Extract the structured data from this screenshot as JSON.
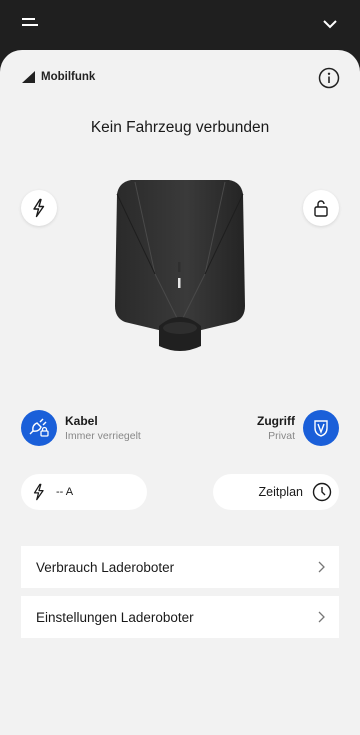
{
  "network": {
    "label": "Mobilfunk",
    "icon": "signal-icon"
  },
  "status_title": "Kein Fahrzeug verbunden",
  "cable": {
    "title": "Kabel",
    "subtitle": "Immer verriegelt",
    "icon": "plug-lock-icon"
  },
  "access": {
    "title": "Zugriff",
    "subtitle": "Privat",
    "icon": "shield-icon"
  },
  "current": {
    "value": "-- A",
    "icon": "lightning-icon"
  },
  "schedule": {
    "label": "Zeitplan",
    "icon": "clock-icon"
  },
  "menu": [
    {
      "label": "Verbrauch Laderoboter"
    },
    {
      "label": "Einstellungen Laderoboter"
    }
  ],
  "colors": {
    "accent": "#1a5fd9",
    "background": "#f2f2f2",
    "topbar": "#1f1f1f"
  }
}
